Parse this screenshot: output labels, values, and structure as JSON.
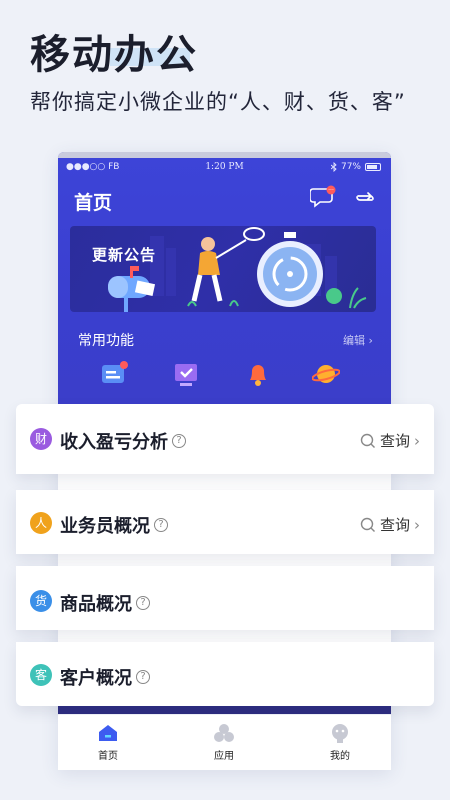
{
  "hero": {
    "title": "移动办公",
    "subtitle": "帮你搞定小微企业的“人、财、货、客”"
  },
  "status_bar": {
    "carrier": "●●●○○ FB",
    "time": "1:20 PM",
    "battery": "77%"
  },
  "app": {
    "page_title": "首页",
    "banner_text": "更新公告",
    "common_functions": "常用功能",
    "edit": "编辑 ›"
  },
  "cards": [
    {
      "badge": "财",
      "label": "收入盈亏分析",
      "query": "查询",
      "color": "#9a5be0"
    },
    {
      "badge": "人",
      "label": "业务员概况",
      "query": "查询",
      "color": "#f0a21c"
    },
    {
      "badge": "货",
      "label": "商品概况",
      "color": "#3a8fe8"
    },
    {
      "badge": "客",
      "label": "客户概况",
      "color": "#3ec2b8"
    }
  ],
  "tabs": [
    {
      "label": "首页"
    },
    {
      "label": "应用"
    },
    {
      "label": "我的"
    }
  ],
  "colors": {
    "primary": "#3d44d8",
    "background": "#eef1f8"
  },
  "icons": {
    "message": "message-bubble-icon",
    "refresh": "refresh-icon",
    "help": "question-circle-icon",
    "search": "search-icon"
  }
}
